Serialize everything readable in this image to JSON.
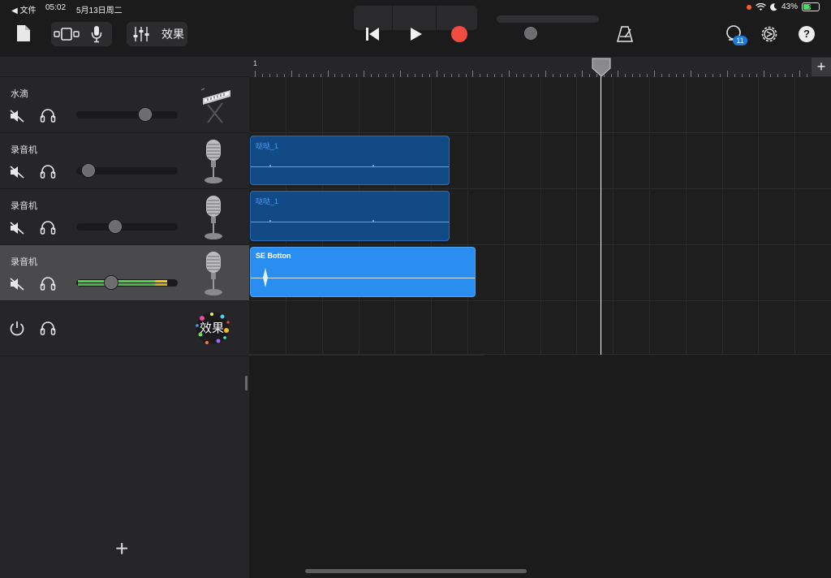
{
  "status_bar": {
    "back_label": "◀ 文件",
    "time": "05:02",
    "date": "5月13日周二",
    "battery_percent": "43%",
    "battery_level": 0.43
  },
  "toolbar": {
    "effects_label": "效果",
    "notification_count": "11",
    "help_label": "?",
    "master_volume": 0.33
  },
  "tracks": [
    {
      "name": "水滴",
      "instrument": "keyboard",
      "volume": 0.68
    },
    {
      "name": "录音机",
      "instrument": "microphone",
      "volume": 0.12
    },
    {
      "name": "录音机",
      "instrument": "microphone",
      "volume": 0.38
    },
    {
      "name": "录音机",
      "instrument": "microphone",
      "volume": 0.34,
      "selected": true
    }
  ],
  "effects_track": {
    "label": "效果"
  },
  "timeline": {
    "ruler_start": "1",
    "add_section_label": "+",
    "regions": [
      {
        "lane": 1,
        "title": "哒哒_1",
        "style": "dark"
      },
      {
        "lane": 2,
        "title": "哒哒_1",
        "style": "dark"
      },
      {
        "lane": 3,
        "title": "SE Botton",
        "style": "light"
      }
    ]
  },
  "add_track_label": "+",
  "colors": {
    "record": "#f24b3f",
    "region_dark": "#124a86",
    "region_light": "#2a8ef0",
    "badge": "#1a7ae0"
  }
}
